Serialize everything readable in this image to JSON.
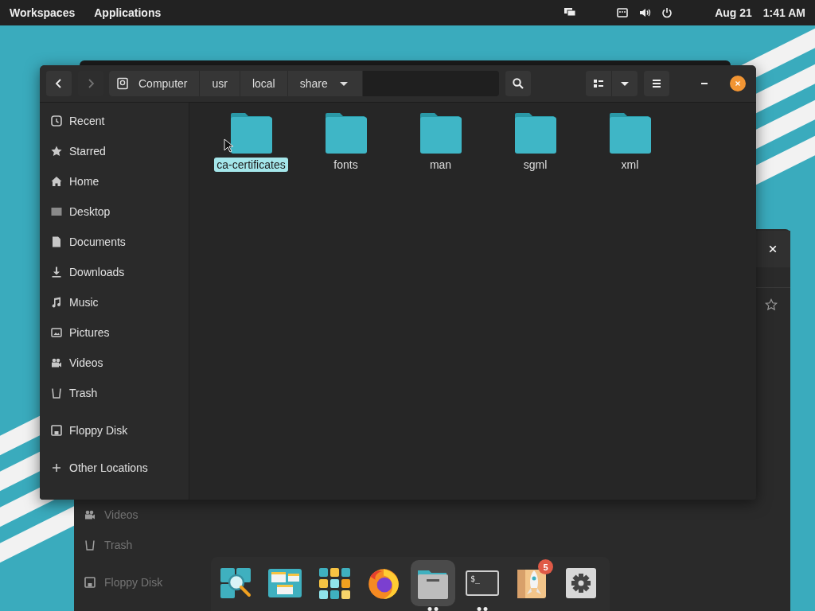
{
  "top_bar": {
    "menus": [
      "Workspaces",
      "Applications"
    ],
    "date": "Aug 21",
    "time": "1:41 AM"
  },
  "background_window": {
    "sidebar_items": [
      "Videos",
      "Trash",
      "Floppy Disk"
    ]
  },
  "window": {
    "nav": [
      {
        "kind": "back",
        "disabled": false
      },
      {
        "kind": "forward",
        "disabled": true
      }
    ],
    "path": [
      "Computer",
      "usr",
      "local",
      "share"
    ],
    "sidebar": {
      "places": [
        "Recent",
        "Starred",
        "Home",
        "Desktop",
        "Documents",
        "Downloads",
        "Music",
        "Pictures",
        "Videos",
        "Trash"
      ],
      "devices": [
        "Floppy Disk"
      ],
      "other": [
        "Other Locations"
      ]
    },
    "folders": [
      {
        "name": "ca-certificates",
        "selected": true
      },
      {
        "name": "fonts",
        "selected": false
      },
      {
        "name": "man",
        "selected": false
      },
      {
        "name": "sgml",
        "selected": false
      },
      {
        "name": "xml",
        "selected": false
      }
    ]
  },
  "dock": {
    "items": [
      {
        "kind": "search",
        "active": false,
        "running": false
      },
      {
        "kind": "workspaces",
        "active": false,
        "running": false
      },
      {
        "kind": "apps",
        "active": false,
        "running": false
      },
      {
        "kind": "browser",
        "active": false,
        "running": false
      },
      {
        "kind": "files",
        "active": true,
        "running": true
      },
      {
        "kind": "terminal",
        "active": false,
        "running": true,
        "prompt": "$_"
      },
      {
        "kind": "shop",
        "active": false,
        "running": false,
        "badge": "5"
      },
      {
        "kind": "settings",
        "active": false,
        "running": false
      }
    ]
  }
}
